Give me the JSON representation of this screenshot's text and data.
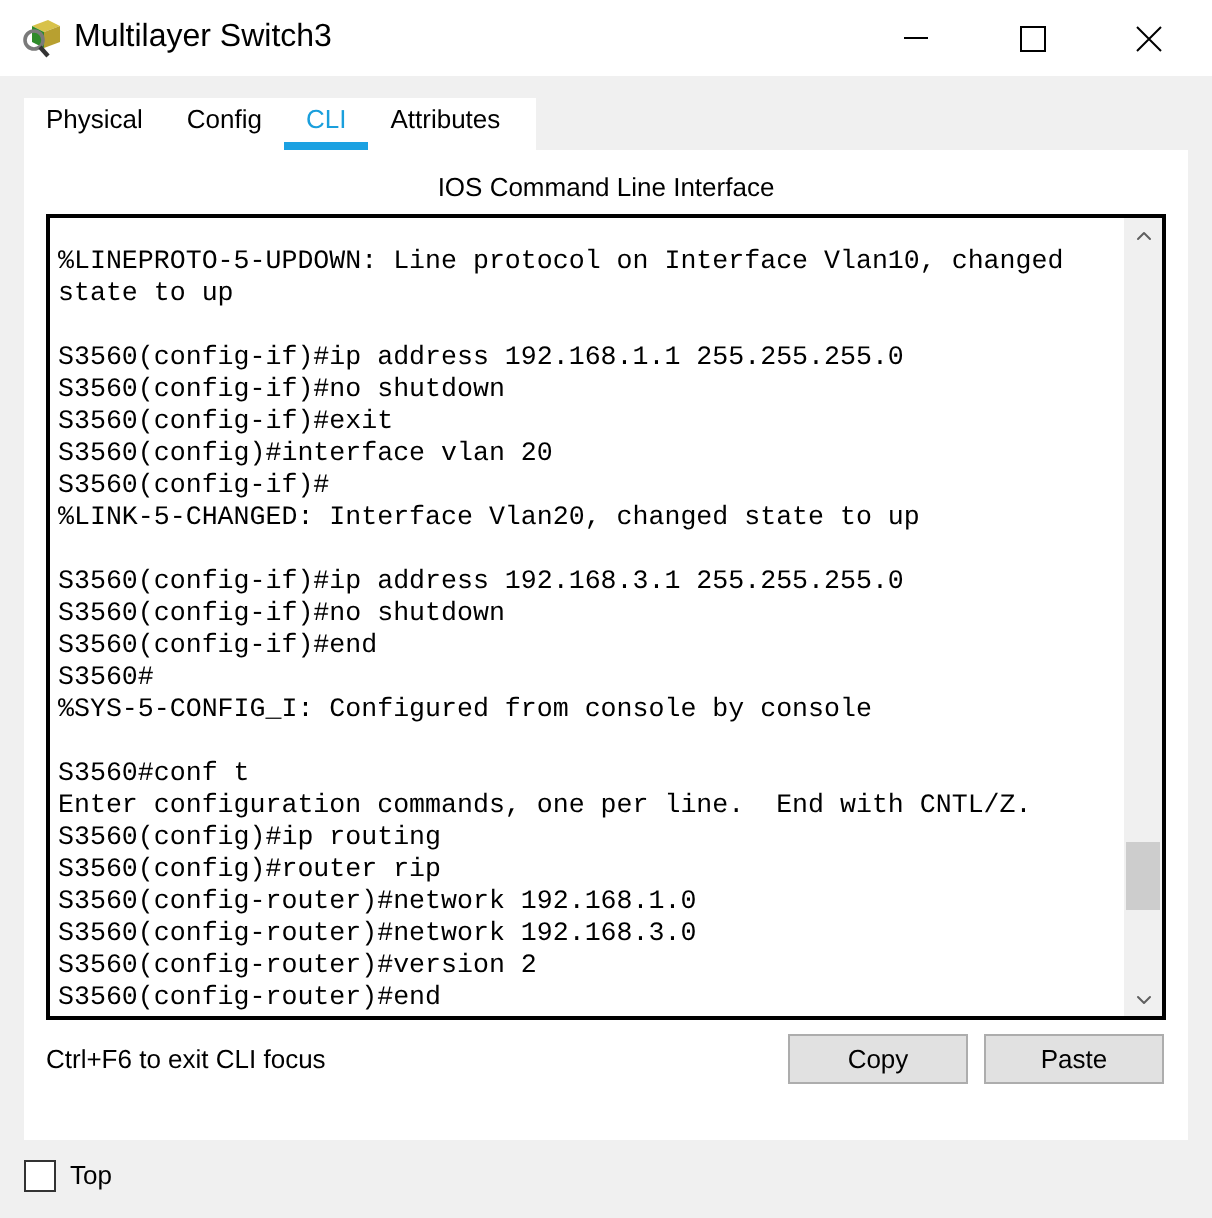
{
  "window": {
    "title": "Multilayer Switch3"
  },
  "tabs": [
    {
      "label": "Physical",
      "selected": false
    },
    {
      "label": "Config",
      "selected": false
    },
    {
      "label": "CLI",
      "selected": true
    },
    {
      "label": "Attributes",
      "selected": false
    }
  ],
  "cli": {
    "heading": "IOS Command Line Interface",
    "output_blocks": [
      [
        "%LINEPROTO-5-UPDOWN: Line protocol on Interface Vlan10, changed",
        "state to up"
      ],
      [
        "S3560(config-if)#ip address 192.168.1.1 255.255.255.0",
        "S3560(config-if)#no shutdown",
        "S3560(config-if)#exit",
        "S3560(config)#interface vlan 20",
        "S3560(config-if)#",
        "%LINK-5-CHANGED: Interface Vlan20, changed state to up"
      ],
      [
        "S3560(config-if)#ip address 192.168.3.1 255.255.255.0",
        "S3560(config-if)#no shutdown",
        "S3560(config-if)#end",
        "S3560#",
        "%SYS-5-CONFIG_I: Configured from console by console"
      ],
      [
        "S3560#conf t",
        "Enter configuration commands, one per line.  End with CNTL/Z.",
        "S3560(config)#ip routing",
        "S3560(config)#router rip",
        "S3560(config-router)#network 192.168.1.0",
        "S3560(config-router)#network 192.168.3.0",
        "S3560(config-router)#version 2",
        "S3560(config-router)#end"
      ]
    ]
  },
  "hint": "Ctrl+F6 to exit CLI focus",
  "buttons": [
    {
      "label": "Copy"
    },
    {
      "label": "Paste"
    }
  ],
  "top_checkbox": {
    "label": "Top",
    "checked": false
  }
}
